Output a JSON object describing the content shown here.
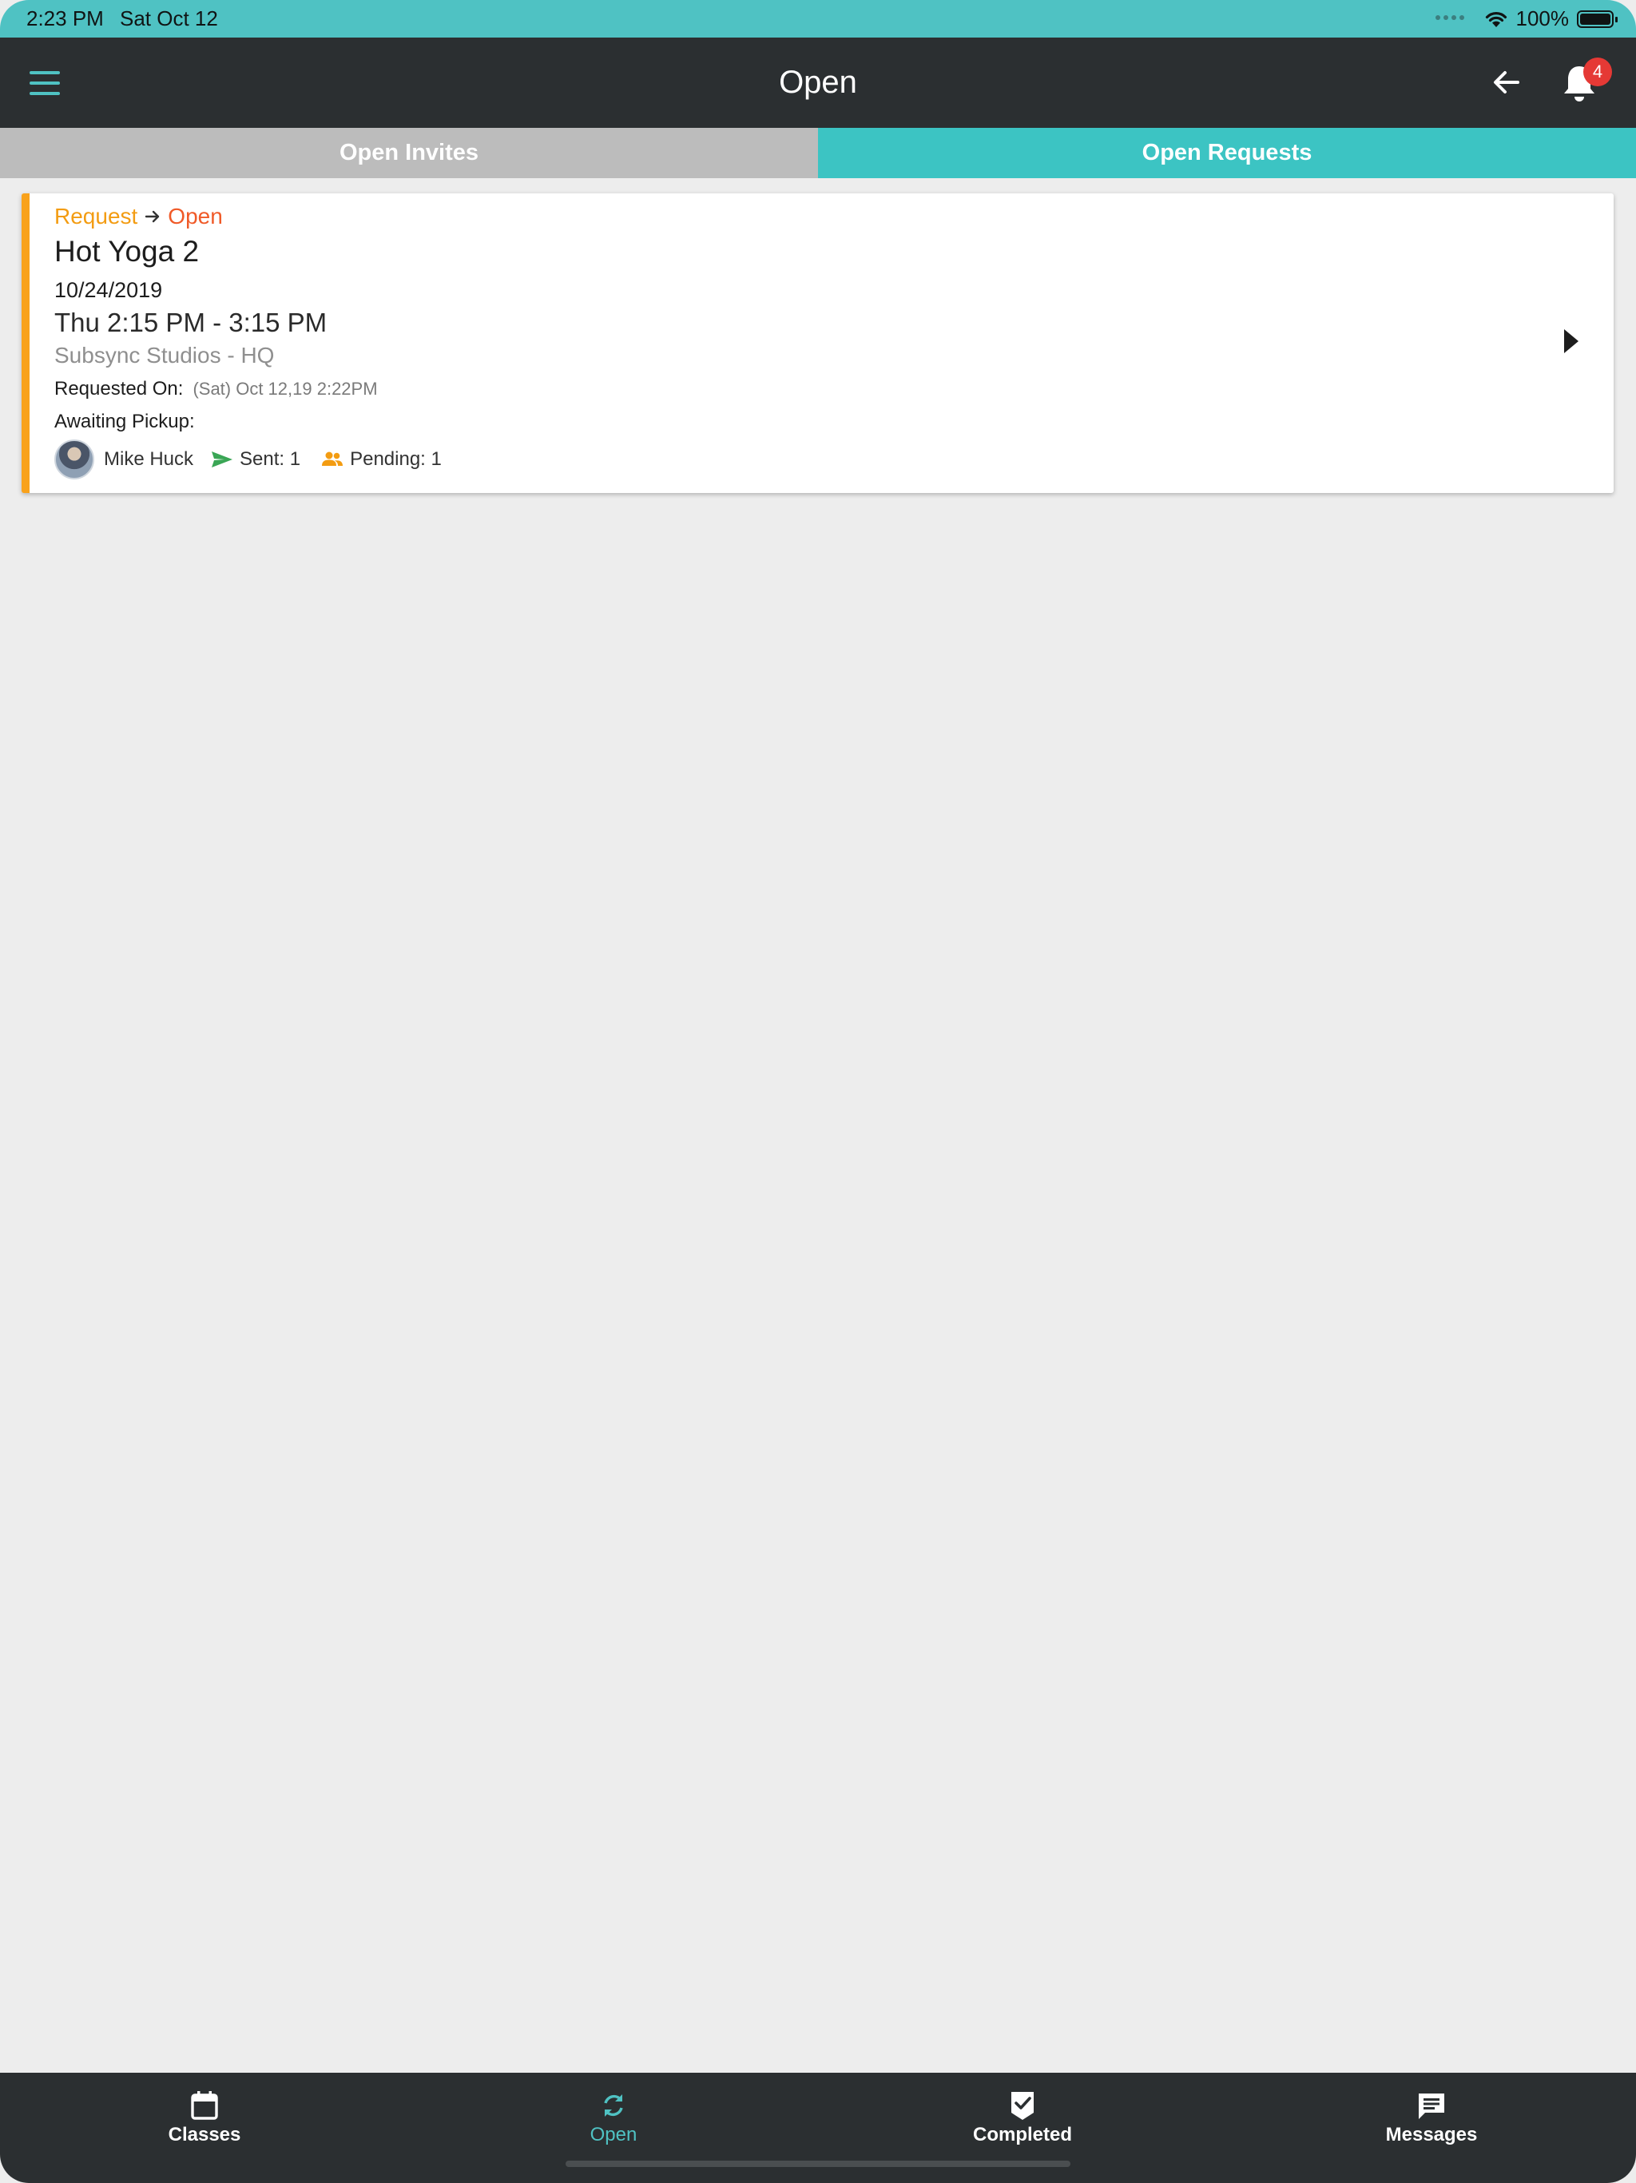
{
  "status_bar": {
    "time": "2:23 PM",
    "date": "Sat Oct 12",
    "battery": "100%"
  },
  "header": {
    "title": "Open",
    "notification_count": "4",
    "accent_color": "#4fc2c3"
  },
  "tabs": [
    {
      "label": "Open Invites",
      "active": false
    },
    {
      "label": "Open Requests",
      "active": true
    }
  ],
  "requests": [
    {
      "status_from": "Request",
      "status_to": "Open",
      "title": "Hot Yoga 2",
      "date": "10/24/2019",
      "time": "Thu 2:15 PM - 3:15 PM",
      "location": "Subsync Studios - HQ",
      "requested_on_label": "Requested On:",
      "requested_on_value": "(Sat) Oct 12,19 2:22PM",
      "awaiting_label": "Awaiting Pickup:",
      "person_name": "Mike Huck",
      "sent_label": "Sent: 1",
      "pending_label": "Pending: 1",
      "accent_color": "#f9a21b"
    }
  ],
  "bottom_nav": [
    {
      "label": "Classes",
      "icon": "calendar-icon",
      "active": false
    },
    {
      "label": "Open",
      "icon": "refresh-icon",
      "active": true
    },
    {
      "label": "Completed",
      "icon": "check-badge-icon",
      "active": false
    },
    {
      "label": "Messages",
      "icon": "message-icon",
      "active": false
    }
  ]
}
